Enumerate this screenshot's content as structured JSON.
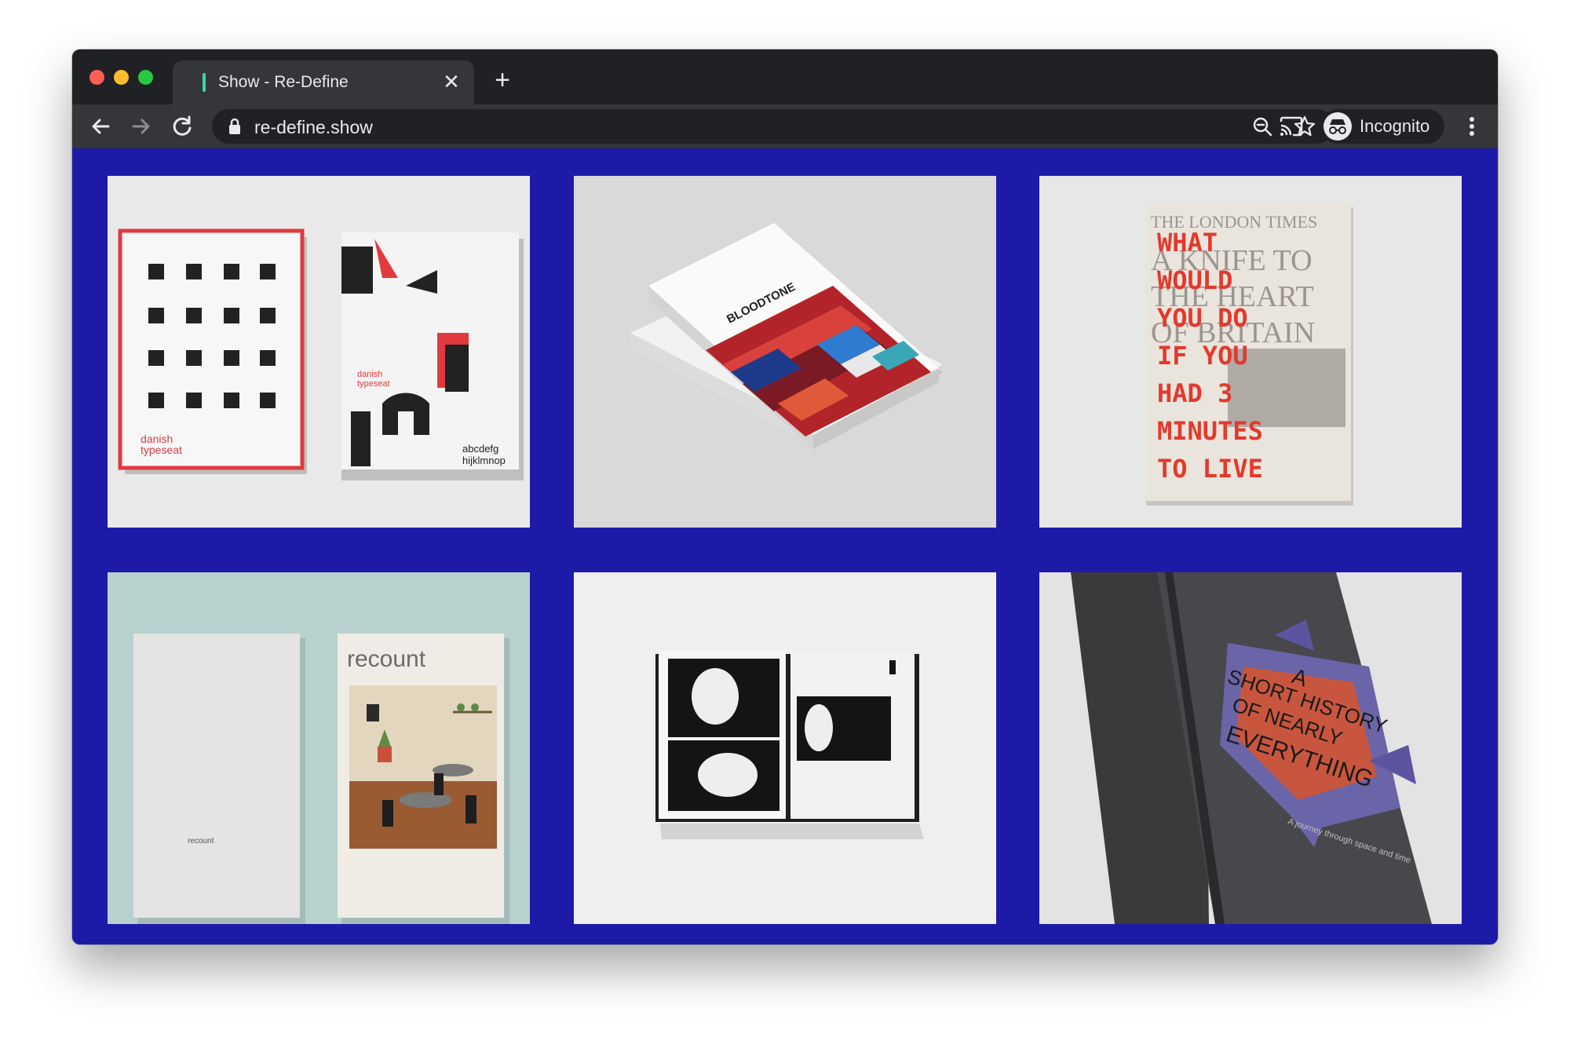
{
  "browser": {
    "tab_title": "Show - Re-Define",
    "tab_close": "✕",
    "new_tab": "+",
    "url": "re-define.show",
    "profile_label": "Incognito",
    "icons": [
      "back-arrow-icon",
      "forward-arrow-icon",
      "reload-icon",
      "lock-icon",
      "zoom-icon",
      "star-icon",
      "cast-icon",
      "incognito-icon",
      "menu-icon"
    ]
  },
  "page": {
    "background": "#1e1aa8",
    "cards": [
      {
        "label": "danish typeseat",
        "texts": [
          "danish",
          "typeseat",
          "abcdefg",
          "hijklmnop"
        ]
      },
      {
        "label": "BLOODTONE",
        "texts": [
          "BLOODTONE"
        ]
      },
      {
        "label": "THE LONDON TIMES poster",
        "texts": [
          "THE LONDON TIMES",
          "A KNIFE TO",
          "THE HEART",
          "OF BRITAIN",
          "WHAT",
          "WOULD",
          "YOU DO",
          "IF YOU",
          "HAD 3",
          "MINUTES",
          "TO LIVE"
        ]
      },
      {
        "label": "recount",
        "texts": [
          "recount",
          "recount"
        ]
      },
      {
        "label": "open comic book",
        "texts": []
      },
      {
        "label": "A SHORT HISTORY OF NEARLY EVERYTHING",
        "texts": [
          "A",
          "SHORT HISTORY",
          "OF NEARLY",
          "EVERYTHING",
          "A journey through space and time"
        ]
      }
    ]
  }
}
